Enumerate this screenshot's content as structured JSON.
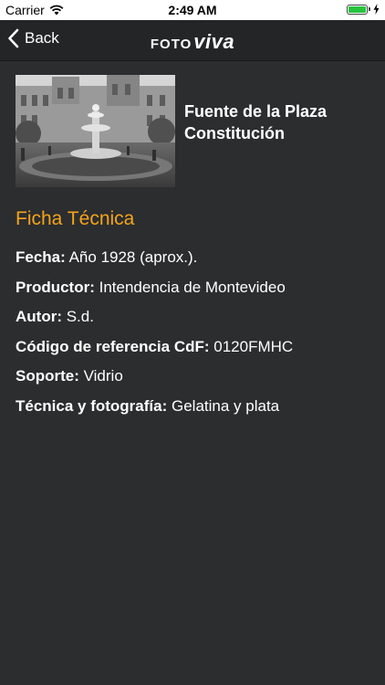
{
  "status_bar": {
    "carrier": "Carrier",
    "time": "2:49 AM",
    "battery_level": 1.0
  },
  "nav": {
    "back_label": "Back",
    "logo_part1": "FOTO",
    "logo_part2": "viva"
  },
  "item": {
    "title": "Fuente de la Plaza Constitución"
  },
  "section": {
    "heading": "Ficha Técnica"
  },
  "details": [
    {
      "label": "Fecha:",
      "value": "Año 1928 (aprox.)."
    },
    {
      "label": "Productor:",
      "value": "Intendencia de Montevideo"
    },
    {
      "label": "Autor:",
      "value": "S.d."
    },
    {
      "label": "Código de referencia CdF:",
      "value": "0120FMHC"
    },
    {
      "label": "Soporte:",
      "value": "Vidrio"
    },
    {
      "label": "Técnica y fotografía:",
      "value": "Gelatina y plata"
    }
  ],
  "colors": {
    "background": "#2b2d2f",
    "nav_background": "#232527",
    "accent": "#f5a31b",
    "battery": "#27c43e"
  }
}
